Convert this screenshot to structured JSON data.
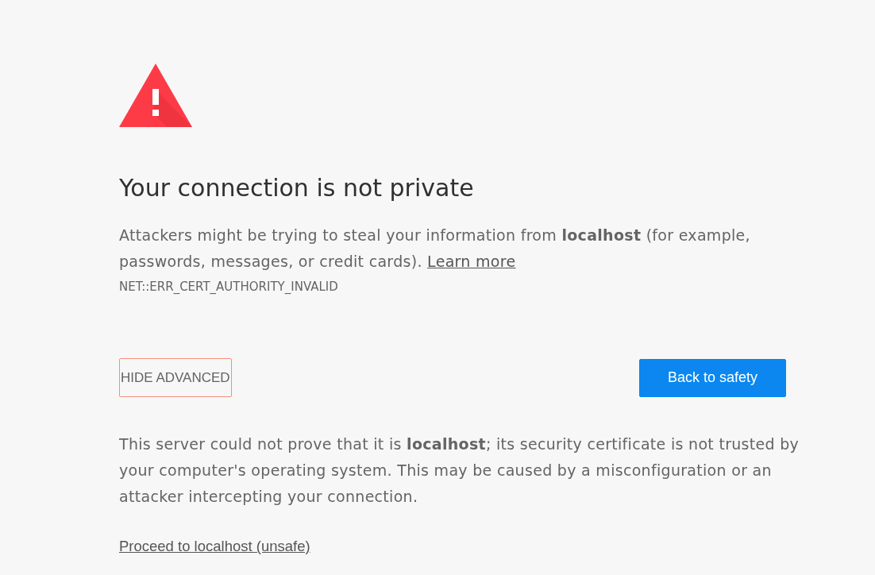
{
  "warning": {
    "title": "Your connection is not private",
    "message": "Attackers might be trying to steal your information from **localhost** (for example, passwords, messages, or credit cards).",
    "learn_more_link": "Learn more",
    "error_code": "NET::ERR_CERT_AUTHORITY_INVALID"
  },
  "buttons": [
    {
      "kind": "secondary",
      "label": "HIDE ADVANCED",
      "focused": true
    },
    {
      "kind": "primary",
      "label": "Back to safety",
      "focused": false
    }
  ],
  "details": {
    "text": "This server could not prove that it is **localhost**; its security certificate is not trusted by your computer's operating system. This may be caused by a misconfiguration or an attacker intercepting your connection.",
    "proceed_link": "Proceed to localhost (unsafe)"
  }
}
